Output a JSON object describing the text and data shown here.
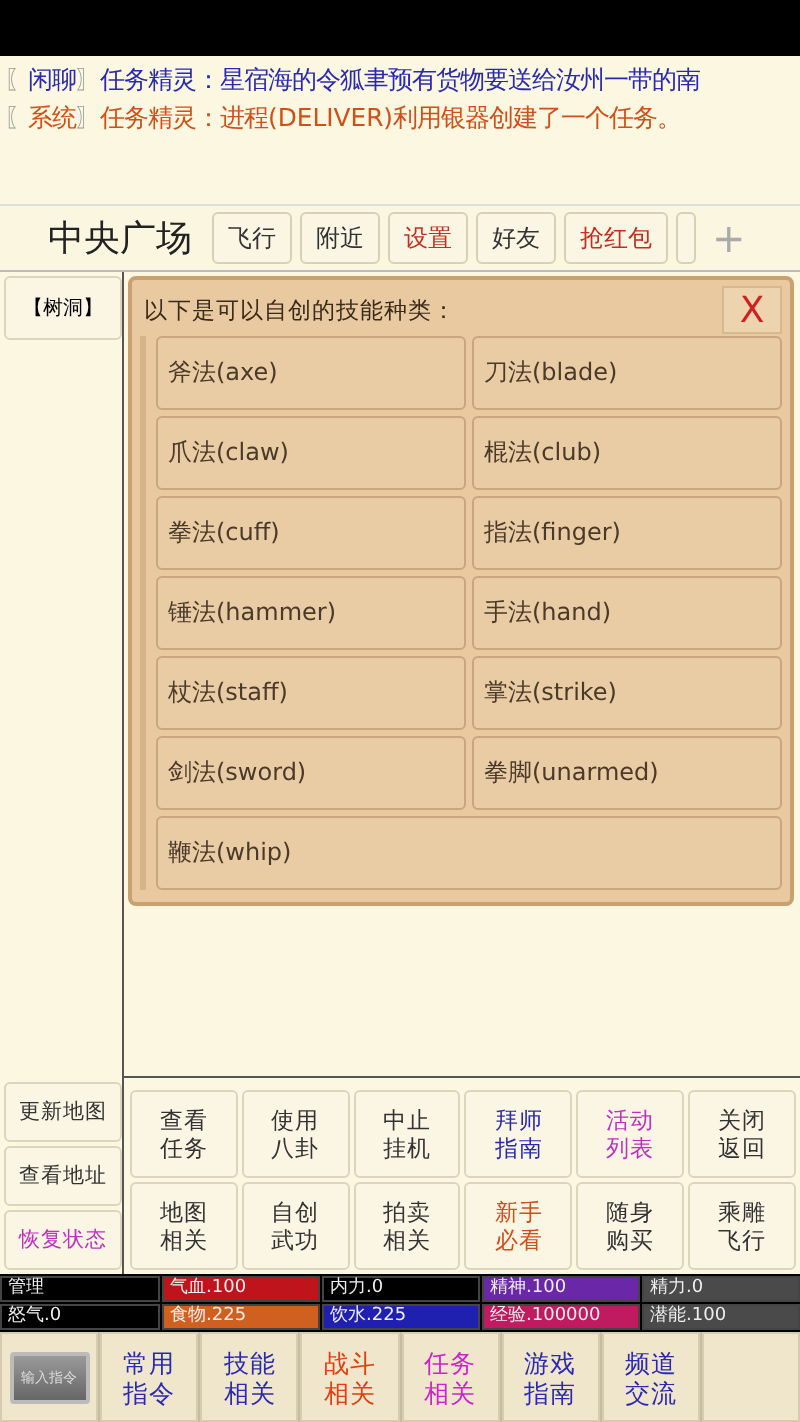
{
  "chat": [
    {
      "open": "〖",
      "channel": "闲聊",
      "close": "〗",
      "text": "任务精灵：星宿海的令狐聿预有货物要送给汝州一带的南",
      "color": "#2a2ab0"
    },
    {
      "open": "〖",
      "channel": "系统",
      "close": "〗",
      "text": "任务精灵：进程(DELIVER)利用银器创建了一个任务。",
      "color": "#d0501a"
    }
  ],
  "location": {
    "title": "中央广场",
    "buttons": [
      {
        "label": "飞行",
        "color": "#333333"
      },
      {
        "label": "附近",
        "color": "#333333"
      },
      {
        "label": "设置",
        "color": "#c03020"
      },
      {
        "label": "好友",
        "color": "#333333"
      },
      {
        "label": "抢红包",
        "color": "#c03020"
      }
    ],
    "add": "+"
  },
  "sidebar": {
    "top": [
      "【树洞】"
    ],
    "bottom": [
      {
        "label": "更新地图",
        "color": "#333333"
      },
      {
        "label": "查看地址",
        "color": "#333333"
      },
      {
        "label": "恢复状态",
        "color": "#c030c0"
      }
    ]
  },
  "dialog": {
    "title": "以下是可以自创的技能种类：",
    "close": "X",
    "skills": [
      "斧法(axe)",
      "刀法(blade)",
      "爪法(claw)",
      "棍法(club)",
      "拳法(cuff)",
      "指法(finger)",
      "锤法(hammer)",
      "手法(hand)",
      "杖法(staff)",
      "掌法(strike)",
      "剑法(sword)",
      "拳脚(unarmed)",
      "鞭法(whip)"
    ]
  },
  "commands": [
    {
      "label": "查看任务",
      "color": "#333333"
    },
    {
      "label": "使用八卦",
      "color": "#333333"
    },
    {
      "label": "中止挂机",
      "color": "#333333"
    },
    {
      "label": "拜师指南",
      "color": "#2a2ab0"
    },
    {
      "label": "活动列表",
      "color": "#c030c0"
    },
    {
      "label": "关闭返回",
      "color": "#333333"
    },
    {
      "label": "地图相关",
      "color": "#333333"
    },
    {
      "label": "自创武功",
      "color": "#333333"
    },
    {
      "label": "拍卖相关",
      "color": "#333333"
    },
    {
      "label": "新手必看",
      "color": "#d0501a"
    },
    {
      "label": "随身购买",
      "color": "#333333"
    },
    {
      "label": "乘雕飞行",
      "color": "#333333"
    }
  ],
  "stats": [
    {
      "label": "管理",
      "color": "#000000"
    },
    {
      "label": "气血.100",
      "color": "#c0141c"
    },
    {
      "label": "内力.0",
      "color": "#000000"
    },
    {
      "label": "精神.100",
      "color": "#6a28a8"
    },
    {
      "label": "精力.0",
      "color": "#4a4a4a"
    },
    {
      "label": "怒气.0",
      "color": "#000000"
    },
    {
      "label": "食物.225",
      "color": "#d06020"
    },
    {
      "label": "饮水.225",
      "color": "#2020b0"
    },
    {
      "label": "经验.100000",
      "color": "#c01a60"
    },
    {
      "label": "潜能.100",
      "color": "#4a4a4a"
    }
  ],
  "tabs": [
    {
      "kind": "input",
      "label": "输入指令"
    },
    {
      "kind": "text",
      "label": "常用指令",
      "color": "#2a2ab0"
    },
    {
      "kind": "text",
      "label": "技能相关",
      "color": "#2a2ab0"
    },
    {
      "kind": "text",
      "label": "战斗相关",
      "color": "#e04010"
    },
    {
      "kind": "text",
      "label": "任务相关",
      "color": "#d020d0"
    },
    {
      "kind": "text",
      "label": "游戏指南",
      "color": "#2a2ab0"
    },
    {
      "kind": "text",
      "label": "频道交流",
      "color": "#2a2ab0"
    },
    {
      "kind": "empty"
    }
  ]
}
